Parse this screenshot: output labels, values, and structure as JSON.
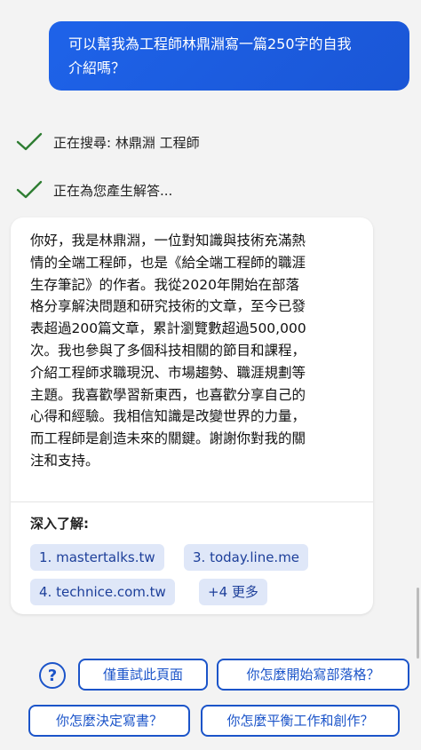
{
  "user_message": {
    "line1": "可以幫我為工程師林鼎淵寫一篇250字的自我",
    "line2": "介紹嗎？"
  },
  "status": {
    "searching": "正在搜尋: 林鼎淵 工程師",
    "generating": "正在為您產生解答..."
  },
  "answer": {
    "lines": [
      "你好，我是林鼎淵，一位對知識與技術充滿熱",
      "情的全端工程師，也是《給全端工程師的職涯",
      "生存筆記》的作者。我從2020年開始在部落",
      "格分享解決問題和研究技術的文章，至今已發",
      "表超過200篇文章，累計瀏覽數超過500,000",
      "次。我也參與了多個科技相關的節目和課程，",
      "介紹工程師求職現況、市場趨勢、職涯規劃等",
      "主題。我喜歡學習新東西，也喜歡分享自己的",
      "心得和經驗。我相信知識是改變世界的力量，",
      "而工程師是創造未來的關鍵。謝謝你對我的關",
      "注和支持。"
    ]
  },
  "learn_more": {
    "label": "深入了解:",
    "sources": [
      "1. mastertalks.tw",
      "3. today.line.me",
      "4. technice.com.tw",
      "+4 更多"
    ]
  },
  "suggestions": {
    "retry": "僅重試此頁面",
    "how_start_blog": "你怎麼開始寫部落格？",
    "how_decide_book": "你怎麼決定寫書？",
    "how_balance": "你怎麼平衡工作和創作？"
  },
  "icons": {
    "check": "check-icon",
    "help": "question-circle-icon"
  },
  "colors": {
    "accent": "#1b54c9",
    "bubble": "#1e63e9",
    "check": "#2e7d32",
    "chip_bg": "#dfe7f8"
  }
}
